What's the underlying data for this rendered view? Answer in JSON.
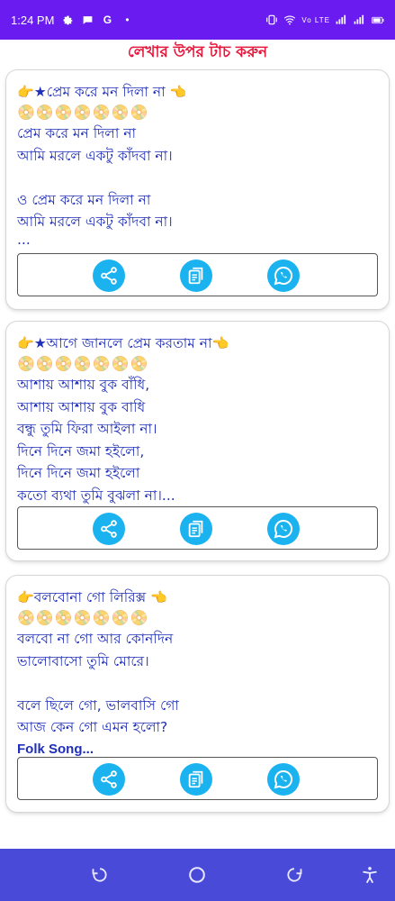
{
  "status_bar": {
    "time": "1:24 PM",
    "left_icons": [
      "gear-icon",
      "chat-icon",
      "google-icon",
      "dot-icon"
    ],
    "right_text": "Vo LTE",
    "battery_text": "+"
  },
  "header": {
    "title": "লেখার উপর টাচ করুন"
  },
  "cards": [
    {
      "title": "প্রেম করে মন দিলা না",
      "discs": "📀📀📀📀📀📀📀",
      "lines": [
        "প্রেম করে মন দিলা না",
        "আমি মরলে একটু কাঁদবা না।",
        "",
        "ও প্রেম করে মন দিলা না",
        "আমি মরলে একটু কাঁদবা না।",
        "..."
      ]
    },
    {
      "title": "আগে জানলে প্রেম করতাম না",
      "discs": "📀📀📀📀📀📀📀",
      "lines": [
        "আশায় আশায় বুক বাঁধি,",
        "আশায় আশায় বুক বাধি",
        "বন্ধু তুমি ফিরা আইলা না।",
        "দিনে দিনে জমা হইলো,",
        "দিনে দিনে জমা হইলো",
        "কতো ব্যথা তুমি বুঝলা না।..."
      ]
    },
    {
      "title": "বলবোনা গো লিরিক্স",
      "discs": "📀📀📀📀📀📀📀",
      "lines": [
        "বলবো না গো আর কোনদিন",
        "ভালোবাসো তুমি মোরে।",
        "",
        "বলে ছিলে গো, ভালবাসি গো",
        "আজ কেন গো এমন হলো?",
        "Folk  Song..."
      ]
    }
  ],
  "colors": {
    "status_bar": "#6a1cf0",
    "header_text": "#e5183c",
    "card_text": "#1f2fb8",
    "action_button": "#1ab3f0",
    "nav_bar": "#4a4ad8"
  }
}
